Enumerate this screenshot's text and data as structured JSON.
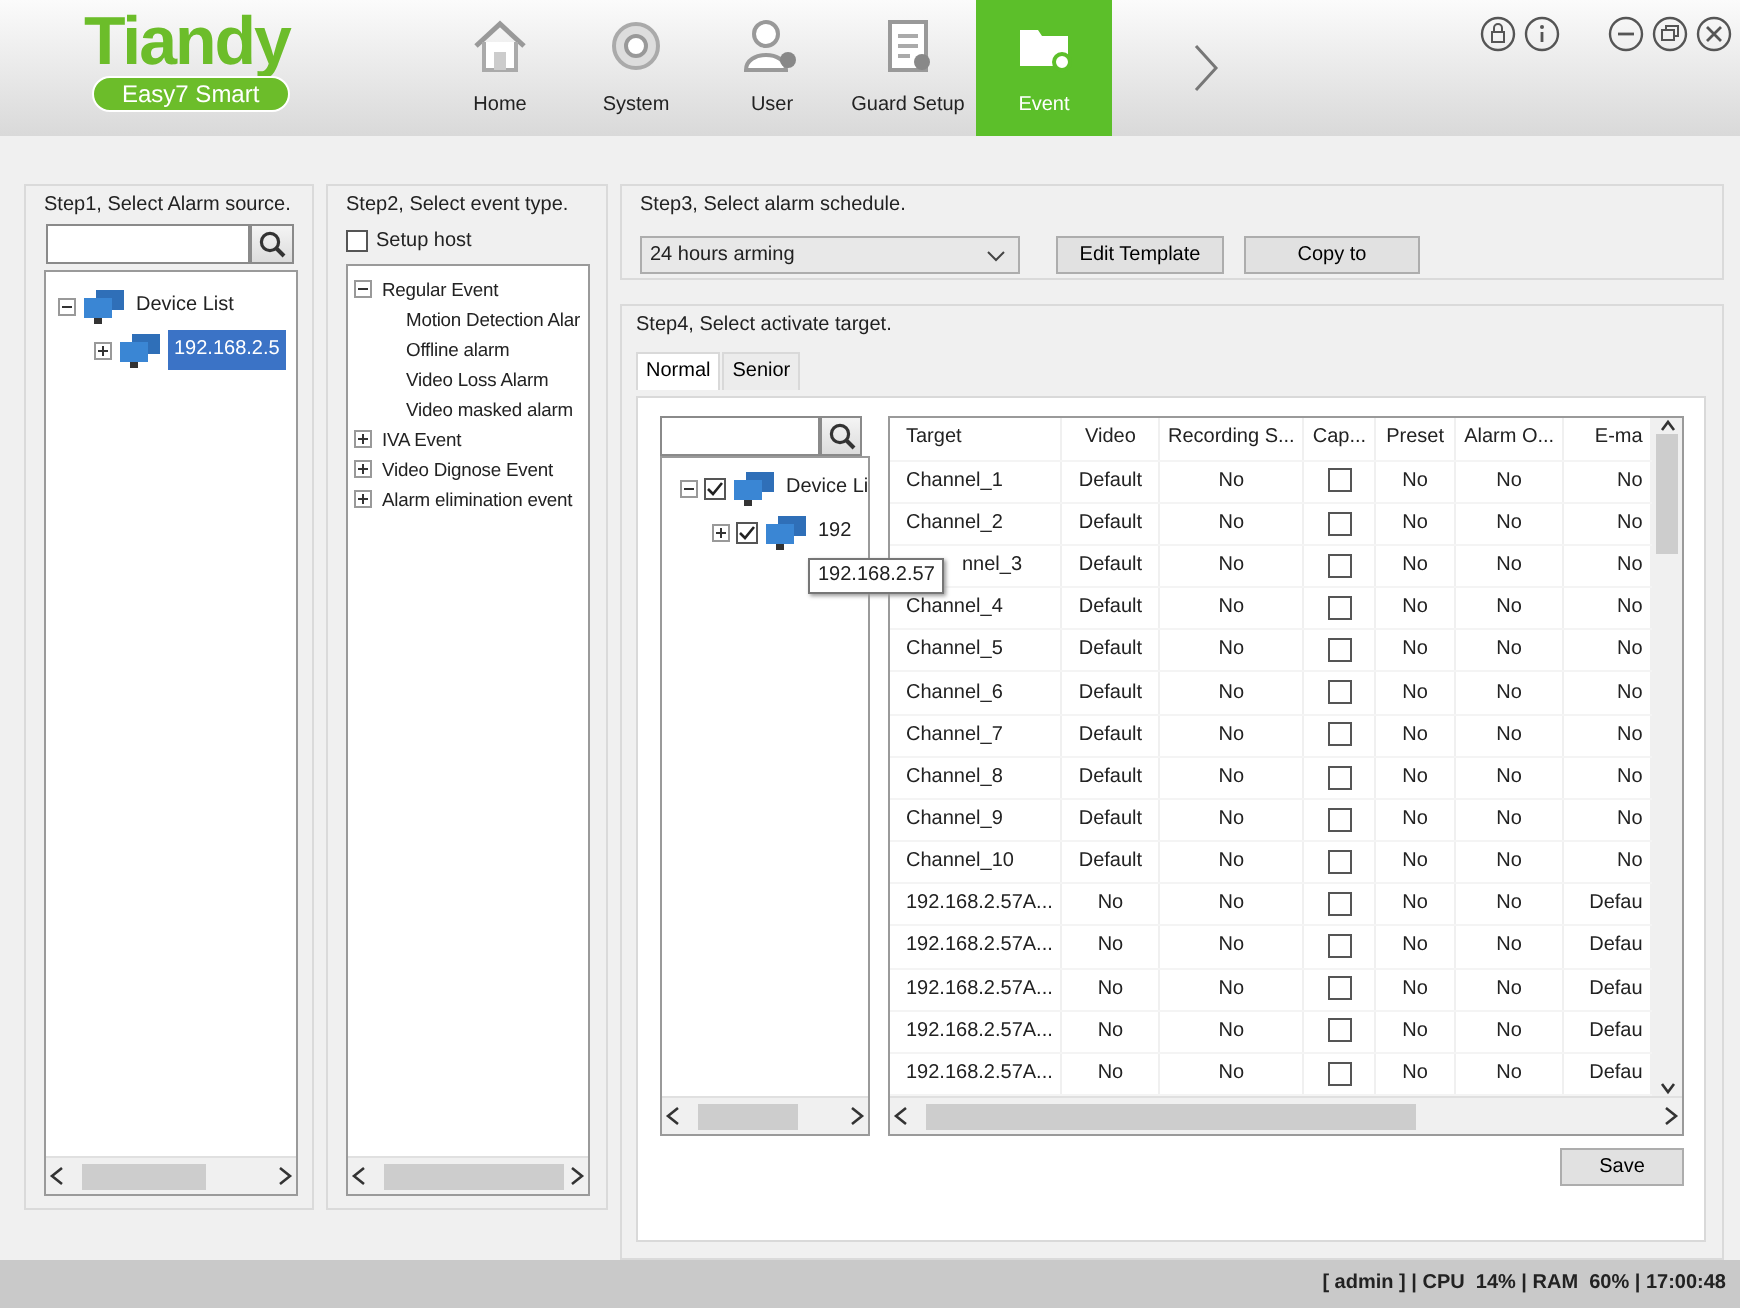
{
  "header": {
    "logo": "Tiandy",
    "logo_subtitle": "Easy7 Smart",
    "nav": [
      {
        "label": "Home",
        "kind": "home",
        "selected": false
      },
      {
        "label": "System",
        "kind": "gear",
        "selected": false
      },
      {
        "label": "User",
        "kind": "user",
        "selected": false
      },
      {
        "label": "Guard Setup",
        "kind": "clipboard",
        "selected": false
      },
      {
        "label": "Event",
        "kind": "folder",
        "selected": true
      }
    ]
  },
  "step1": {
    "title": "Step1, Select Alarm source.",
    "tree": [
      {
        "label": "Device List",
        "expanded": true,
        "selected": false,
        "children": [
          {
            "label": "192.168.2.5",
            "expanded": false,
            "selected": true
          }
        ]
      }
    ]
  },
  "step2": {
    "title": "Step2, Select event type.",
    "setup_host": {
      "label": "Setup host",
      "checked": false
    },
    "tree": [
      {
        "label": "Regular Event",
        "expanded": true,
        "children": [
          {
            "label": "Motion Detection Alar"
          },
          {
            "label": "Offline alarm"
          },
          {
            "label": "Video Loss Alarm"
          },
          {
            "label": "Video masked alarm"
          }
        ]
      },
      {
        "label": "IVA Event",
        "expanded": false
      },
      {
        "label": "Video Dignose Event",
        "expanded": false
      },
      {
        "label": "Alarm elimination event",
        "expanded": false
      }
    ]
  },
  "step3": {
    "title": "Step3, Select alarm schedule.",
    "schedule": "24 hours arming",
    "buttons": [
      "Edit Template",
      "Copy to"
    ]
  },
  "step4": {
    "title": "Step4, Select activate target.",
    "tabs": [
      {
        "label": "Normal",
        "selected": true
      },
      {
        "label": "Senior",
        "selected": false
      }
    ],
    "tree": [
      {
        "label": "Device Li",
        "checked": true,
        "expanded": true,
        "children": [
          {
            "label": "192",
            "checked": true,
            "expanded": false
          }
        ]
      }
    ],
    "tooltip": "192.168.2.57",
    "table": {
      "columns": [
        {
          "label": "Target"
        },
        {
          "label": "Video"
        },
        {
          "label": "Recording S..."
        },
        {
          "label": "Cap...",
          "kind": "checkbox"
        },
        {
          "label": "Preset"
        },
        {
          "label": "Alarm O..."
        },
        {
          "label": "E-ma"
        }
      ],
      "rows": [
        {
          "cells": [
            "Channel_1",
            "Default",
            "No",
            false,
            "No",
            "No",
            "No"
          ]
        },
        {
          "cells": [
            "Channel_2",
            "Default",
            "No",
            false,
            "No",
            "No",
            "No"
          ]
        },
        {
          "cells": [
            "nnel_3",
            "Default",
            "No",
            false,
            "No",
            "No",
            "No"
          ],
          "covered": true
        },
        {
          "cells": [
            "Channel_4",
            "Default",
            "No",
            false,
            "No",
            "No",
            "No"
          ]
        },
        {
          "cells": [
            "Channel_5",
            "Default",
            "No",
            false,
            "No",
            "No",
            "No"
          ]
        },
        {
          "cells": [
            "Channel_6",
            "Default",
            "No",
            false,
            "No",
            "No",
            "No"
          ]
        },
        {
          "cells": [
            "Channel_7",
            "Default",
            "No",
            false,
            "No",
            "No",
            "No"
          ]
        },
        {
          "cells": [
            "Channel_8",
            "Default",
            "No",
            false,
            "No",
            "No",
            "No"
          ]
        },
        {
          "cells": [
            "Channel_9",
            "Default",
            "No",
            false,
            "No",
            "No",
            "No"
          ]
        },
        {
          "cells": [
            "Channel_10",
            "Default",
            "No",
            false,
            "No",
            "No",
            "No"
          ]
        },
        {
          "cells": [
            "192.168.2.57A...",
            "No",
            "No",
            false,
            "No",
            "No",
            "Defau"
          ]
        },
        {
          "cells": [
            "192.168.2.57A...",
            "No",
            "No",
            false,
            "No",
            "No",
            "Defau"
          ]
        },
        {
          "cells": [
            "192.168.2.57A...",
            "No",
            "No",
            false,
            "No",
            "No",
            "Defau"
          ]
        },
        {
          "cells": [
            "192.168.2.57A...",
            "No",
            "No",
            false,
            "No",
            "No",
            "Defau"
          ]
        },
        {
          "cells": [
            "192.168.2.57A...",
            "No",
            "No",
            false,
            "No",
            "No",
            "Defau"
          ]
        }
      ]
    },
    "save": "Save"
  },
  "status_bar": "[ admin ] | CPU  14% | RAM  60% | 17:00:48"
}
